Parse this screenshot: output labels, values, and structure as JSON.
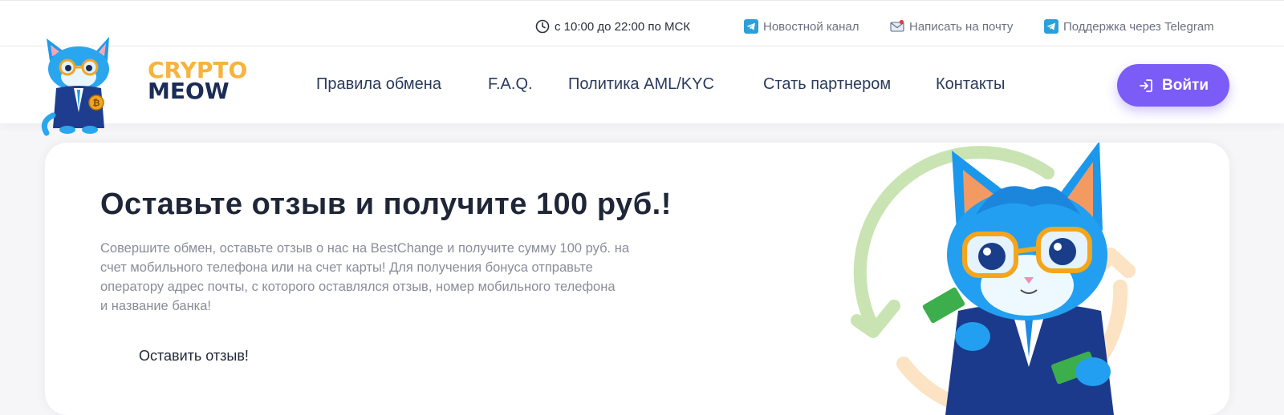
{
  "topbar": {
    "hours": "с 10:00 до 22:00 по МСК",
    "news_channel": "Новостной канал",
    "write_email": "Написать на почту",
    "telegram_support": "Поддержка через Telegram"
  },
  "header": {
    "logo_line1": "CRYPTO",
    "logo_line2": "MEOW",
    "nav": [
      "Правила обмена",
      "F.A.Q.",
      "Политика AML/KYC",
      "Стать партнером",
      "Контакты"
    ],
    "login_label": "Войти"
  },
  "promo": {
    "title": "Оставьте отзыв и получите 100 руб.!",
    "description_lines": [
      "Совершите обмен, оставьте отзыв о нас на BestChange и получите сумму 100 руб. на",
      "счет мобильного телефона или на счет карты! Для получения бонуса отправьте",
      "оператору адрес почты, с которого оставлялся отзыв, номер мобильного телефона",
      "и название банка!"
    ],
    "button_label": "Оставить отзыв!"
  },
  "colors": {
    "accent": "#7b5cf6",
    "logo_orange": "#f7b33d",
    "logo_navy": "#1b2c57",
    "telegram_blue": "#2b9fdc"
  },
  "icons": [
    "clock-icon",
    "telegram-icon",
    "mail-icon",
    "login-arrow-icon",
    "cat-mascot-logo",
    "cat-mascot-hero"
  ]
}
